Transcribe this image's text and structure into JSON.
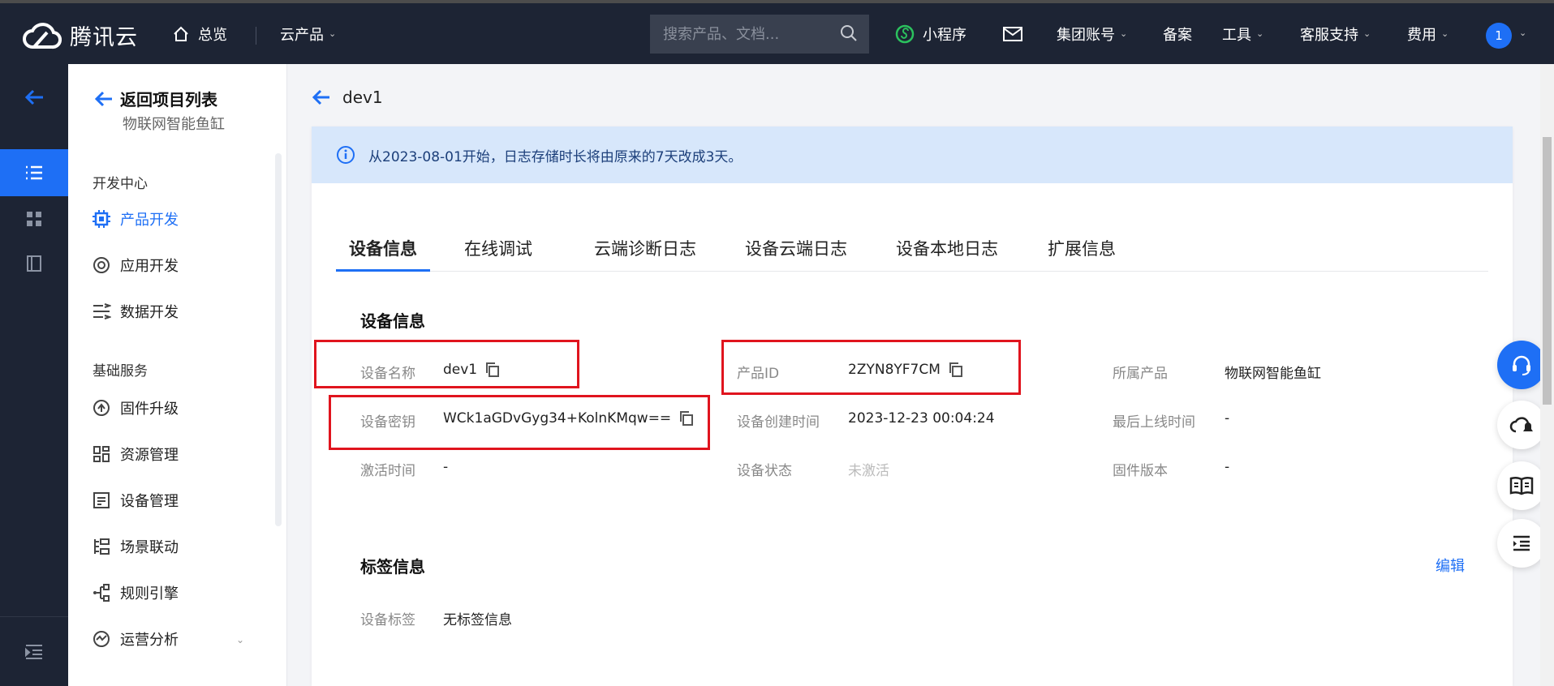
{
  "topnav": {
    "brand": "腾讯云",
    "overview": "总览",
    "cloud_products": "云产品",
    "search_placeholder": "搜索产品、文档...",
    "mini_program": "小程序",
    "group_account": "集团账号",
    "filing": "备案",
    "tools": "工具",
    "support": "客服支持",
    "billing": "费用",
    "user_badge": "1"
  },
  "sidebar": {
    "back_label": "返回项目列表",
    "project_name": "物联网智能鱼缸",
    "group_dev": "开发中心",
    "group_basic": "基础服务",
    "items": [
      {
        "label": "产品开发",
        "icon": "chip-icon",
        "active": true
      },
      {
        "label": "应用开发",
        "icon": "app-icon"
      },
      {
        "label": "数据开发",
        "icon": "data-flow-icon"
      },
      {
        "label": "固件升级",
        "icon": "firmware-icon"
      },
      {
        "label": "资源管理",
        "icon": "resource-icon"
      },
      {
        "label": "设备管理",
        "icon": "device-icon"
      },
      {
        "label": "场景联动",
        "icon": "scene-icon"
      },
      {
        "label": "规则引擎",
        "icon": "rule-icon"
      },
      {
        "label": "运营分析",
        "icon": "analytics-icon"
      }
    ]
  },
  "page": {
    "title": "dev1",
    "notice": "从2023-08-01开始，日志存储时长将由原来的7天改成3天。",
    "tabs": [
      "设备信息",
      "在线调试",
      "云端诊断日志",
      "设备云端日志",
      "设备本地日志",
      "扩展信息"
    ],
    "device_section_title": "设备信息",
    "fields": {
      "device_name_label": "设备名称",
      "device_name": "dev1",
      "product_id_label": "产品ID",
      "product_id": "2ZYN8YF7CM",
      "product_label": "所属产品",
      "product": "物联网智能鱼缸",
      "device_key_label": "设备密钥",
      "device_key": "WCk1aGDvGyg34+KolnKMqw==",
      "created_label": "设备创建时间",
      "created": "2023-12-23 00:04:24",
      "last_online_label": "最后上线时间",
      "last_online": "-",
      "activated_label": "激活时间",
      "activated": "-",
      "status_label": "设备状态",
      "status": "未激活",
      "firmware_label": "固件版本",
      "firmware": "-"
    },
    "tag_section_title": "标签信息",
    "edit_label": "编辑",
    "tag_label": "设备标签",
    "tag_value": "无标签信息"
  },
  "colors": {
    "accent": "#1e6ff5",
    "nav_bg": "#1d2434",
    "highlight_box": "#e0141e",
    "notice_bg": "#d7e7fb"
  }
}
